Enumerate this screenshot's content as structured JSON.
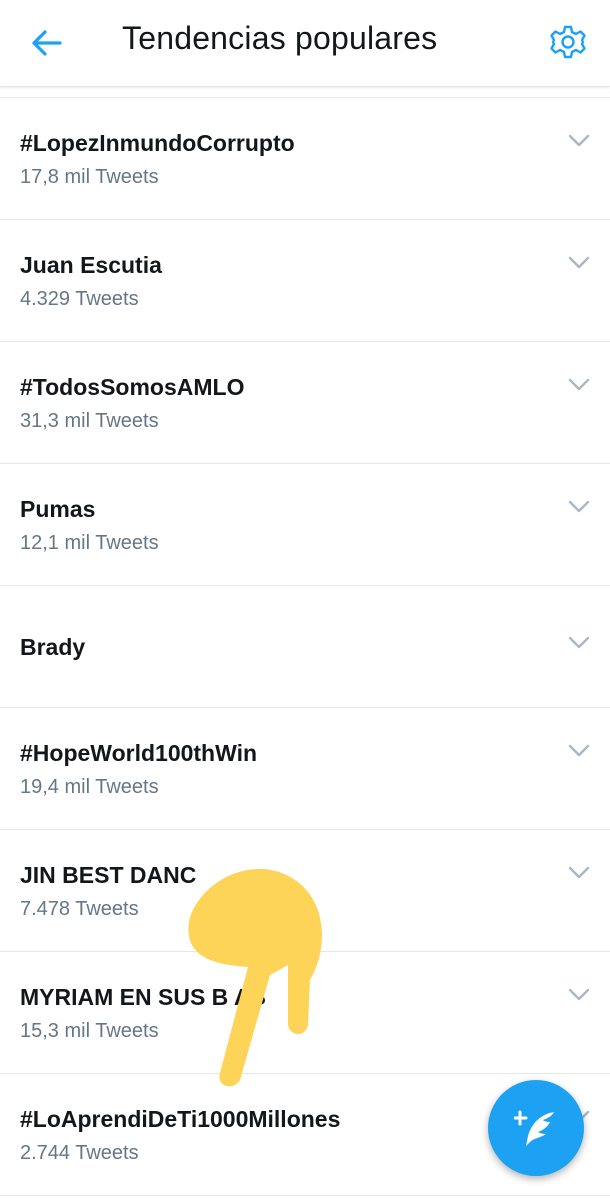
{
  "header": {
    "title": "Tendencias populares",
    "back_icon": "arrow-left-icon",
    "settings_icon": "gear-icon"
  },
  "colors": {
    "accent": "#1da1f2",
    "text_primary": "#14171a",
    "text_secondary": "#657786",
    "divider": "#e1e8ed",
    "overlay_hand": "#fdd458"
  },
  "trends": [
    {
      "name": "#LopezInmundoCorrupto",
      "count": "17,8 mil Tweets"
    },
    {
      "name": "Juan Escutia",
      "count": "4.329 Tweets"
    },
    {
      "name": "#TodosSomosAMLO",
      "count": "31,3 mil Tweets"
    },
    {
      "name": "Pumas",
      "count": "12,1 mil Tweets"
    },
    {
      "name": "Brady",
      "count": ""
    },
    {
      "name": "#HopeWorld100thWin",
      "count": "19,4 mil Tweets"
    },
    {
      "name": "JIN BEST DANC",
      "count": "7.478 Tweets"
    },
    {
      "name": "MYRIAM EN SUS B     AS",
      "count": "15,3 mil Tweets"
    },
    {
      "name": "#LoAprendiDeTi1000Millones",
      "count": "2.744 Tweets"
    }
  ],
  "fab": {
    "icon": "compose-tweet-icon"
  },
  "overlay": {
    "icon": "pointing-hand-emoji-icon"
  }
}
